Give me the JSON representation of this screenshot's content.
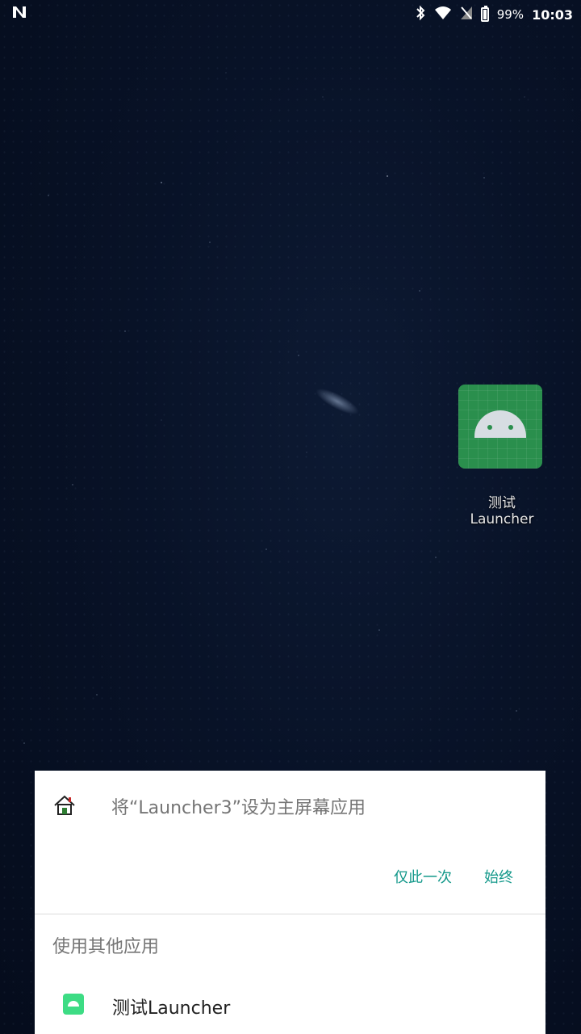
{
  "status_bar": {
    "battery_percent": "99%",
    "time": "10:03",
    "icons": [
      "notification-n-icon",
      "bluetooth-icon",
      "wifi-icon",
      "no-signal-icon",
      "battery-icon"
    ]
  },
  "desktop": {
    "app_label": "测试Launcher"
  },
  "dialog": {
    "title": "将“Launcher3”设为主屏幕应用",
    "btn_once": "仅此一次",
    "btn_always": "始终",
    "other_apps_label": "使用其他应用",
    "apps": [
      {
        "label": "测试Launcher",
        "icon": "android-app-icon"
      }
    ],
    "accent_color": "#13988a"
  }
}
